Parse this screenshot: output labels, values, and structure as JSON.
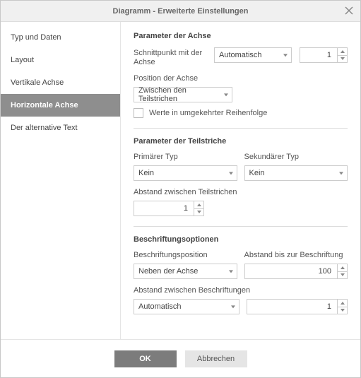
{
  "title": "Diagramm - Erweiterte Einstellungen",
  "sidebar": {
    "items": [
      {
        "label": "Typ und Daten"
      },
      {
        "label": "Layout"
      },
      {
        "label": "Vertikale Achse"
      },
      {
        "label": "Horizontale Achse"
      },
      {
        "label": "Der alternative Text"
      }
    ],
    "active_index": 3
  },
  "axis_params": {
    "section_title": "Parameter der Achse",
    "intersection_label": "Schnittpunkt mit der Achse",
    "intersection_mode": "Automatisch",
    "intersection_value": "1",
    "position_label": "Position der Achse",
    "position_value": "Zwischen den Teilstrichen",
    "reverse_label": "Werte in umgekehrter Reihenfolge",
    "reverse_checked": false
  },
  "tick_params": {
    "section_title": "Parameter der Teilstriche",
    "primary_label": "Primärer Typ",
    "primary_value": "Kein",
    "secondary_label": "Sekundärer Typ",
    "secondary_value": "Kein",
    "interval_label": "Abstand zwischen Teilstrichen",
    "interval_value": "1"
  },
  "label_options": {
    "section_title": "Beschriftungsoptionen",
    "position_label": "Beschriftungsposition",
    "position_value": "Neben der Achse",
    "distance_label": "Abstand bis zur Beschriftung",
    "distance_value": "100",
    "interval_label": "Abstand zwischen Beschriftungen",
    "interval_mode": "Automatisch",
    "interval_value": "1"
  },
  "buttons": {
    "ok": "OK",
    "cancel": "Abbrechen"
  }
}
